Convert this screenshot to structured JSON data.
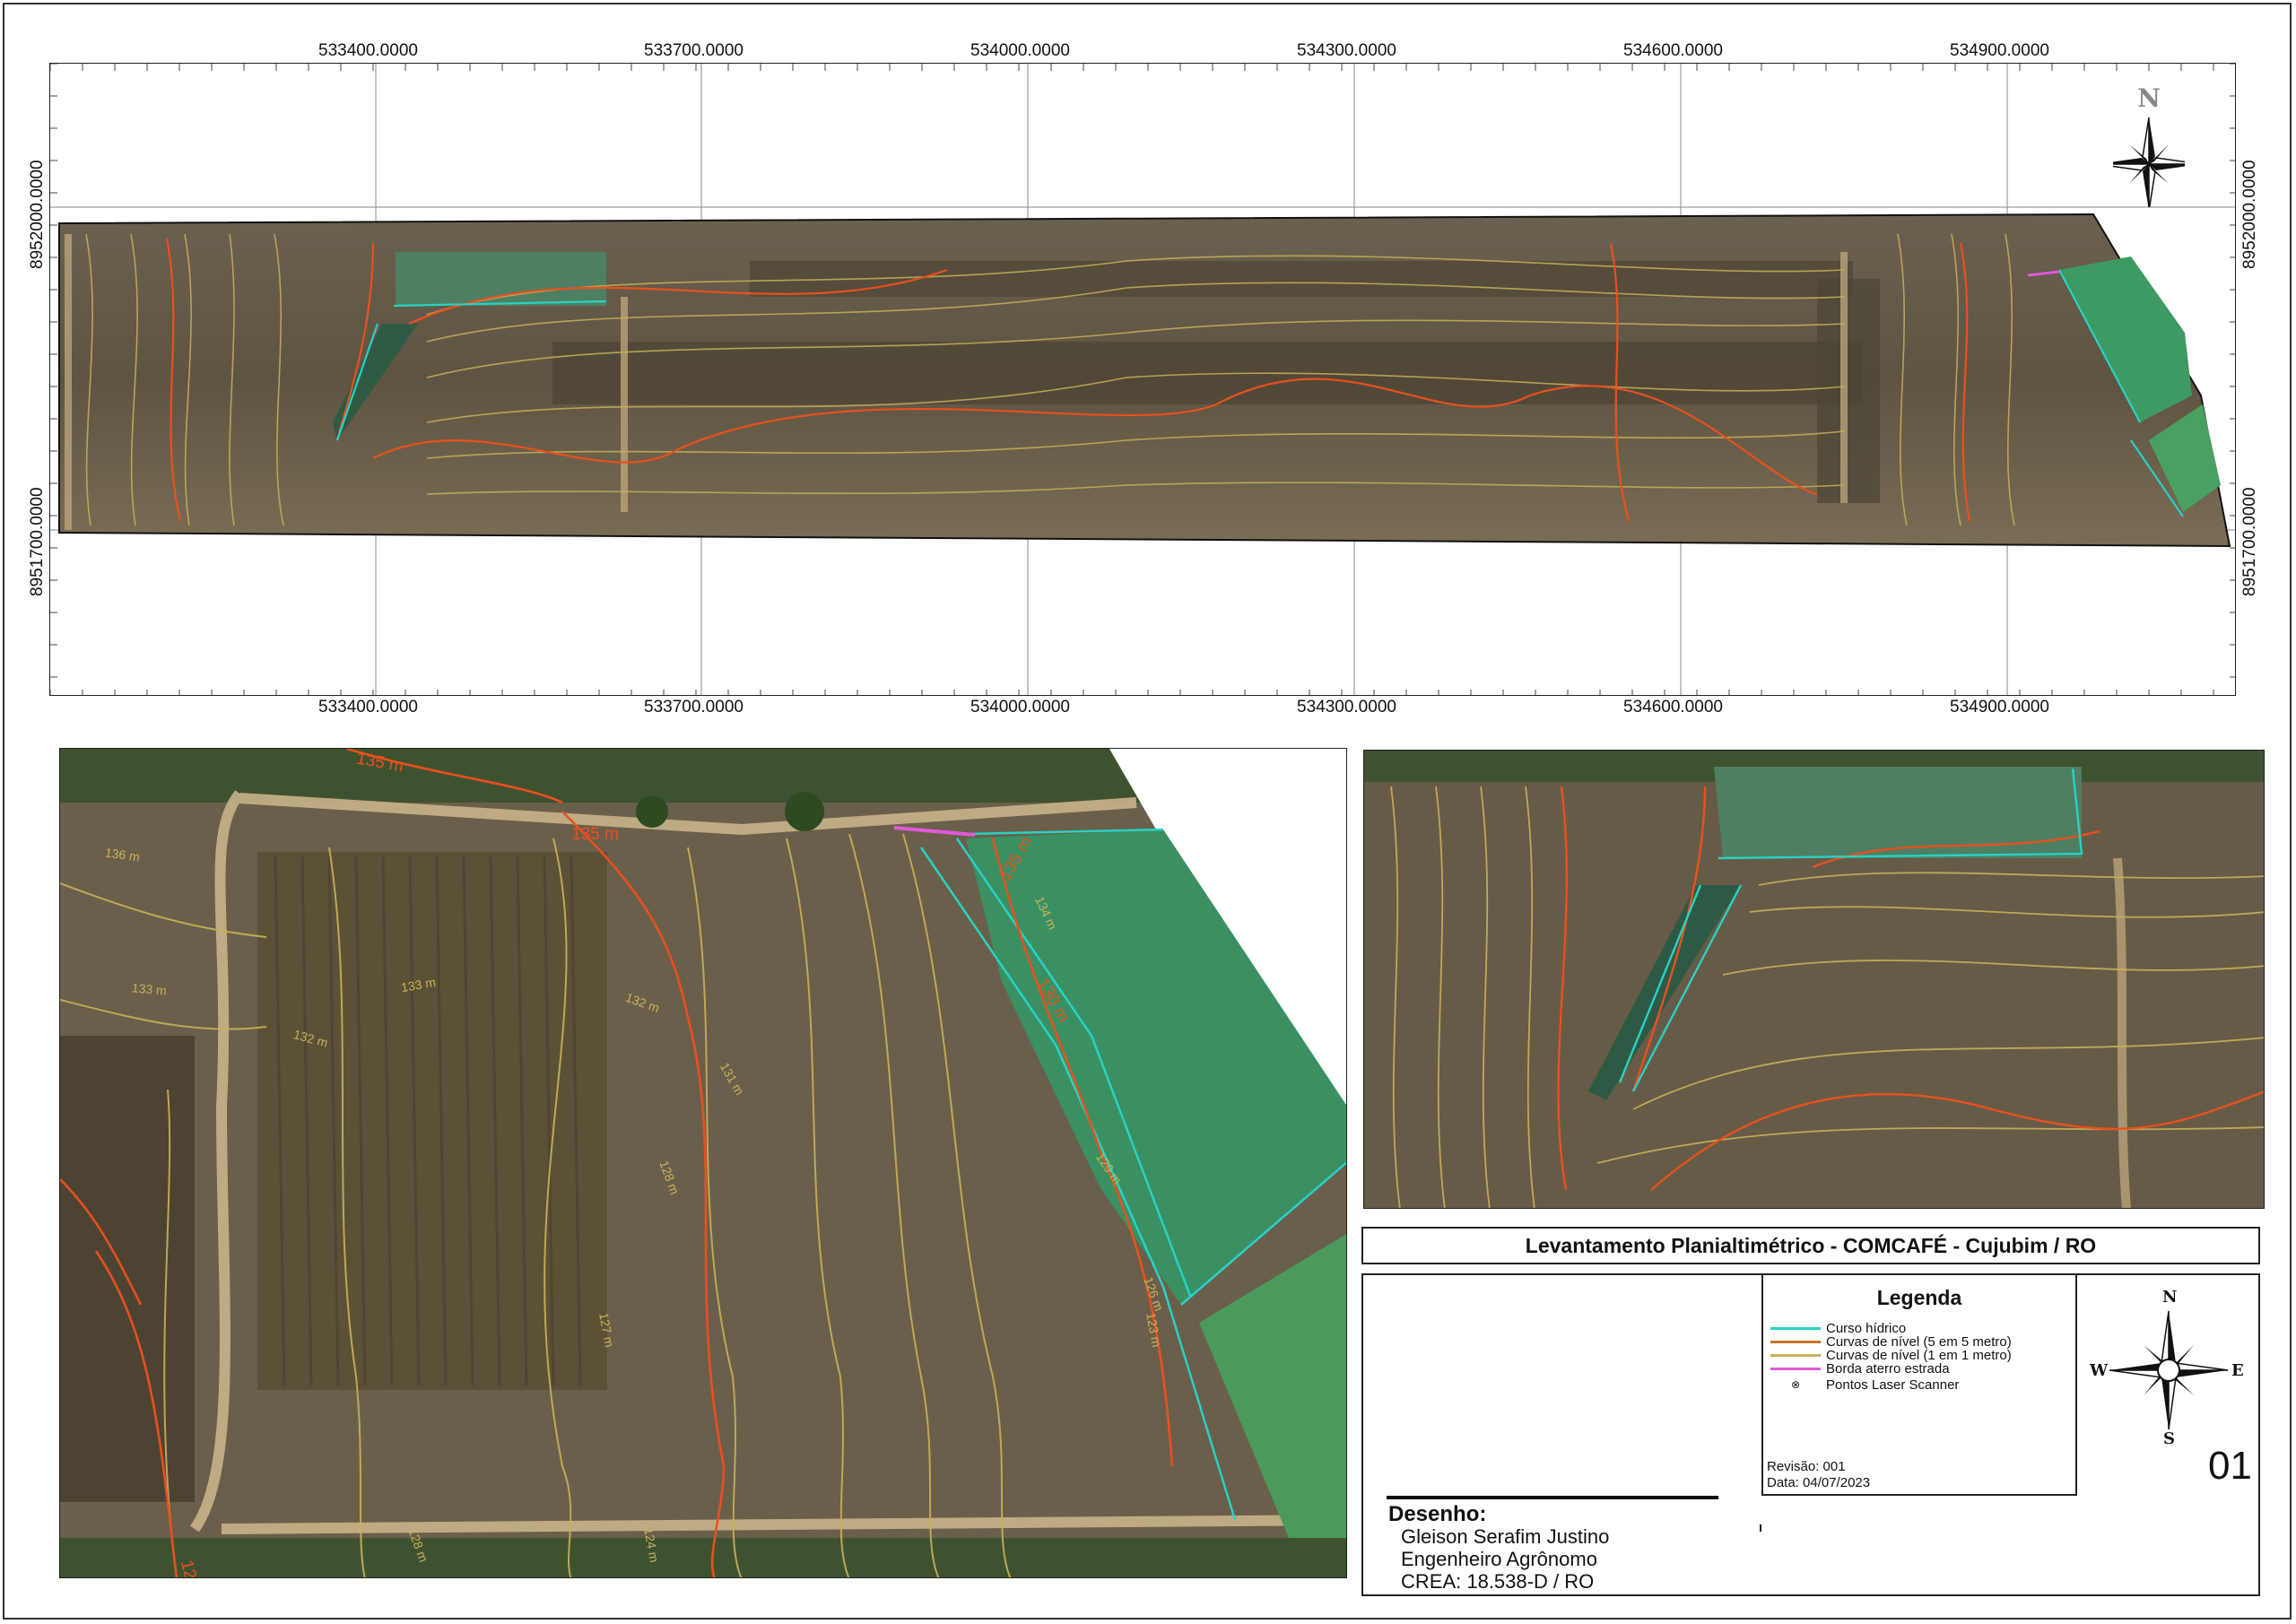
{
  "main_map": {
    "x_labels": [
      "533400.0000",
      "533700.0000",
      "534000.0000",
      "534300.0000",
      "534600.0000",
      "534900.0000"
    ],
    "y_labels": [
      "8952000.0000",
      "8951700.0000"
    ],
    "north_label": "N"
  },
  "detail_left": {
    "contour_labels": [
      "135 m",
      "135 m",
      "136 m",
      "133 m",
      "132 m",
      "135 m",
      "134 m",
      "132 m",
      "131 m",
      "133 m",
      "128 m",
      "130 m",
      "129 m",
      "126 m",
      "127 m",
      "123 m",
      "124 m",
      "125 m",
      "128 m"
    ]
  },
  "title": "Levantamento Planialtimétrico - COMCAFÉ - Cujubim / RO",
  "legend": {
    "title": "Legenda",
    "items": [
      {
        "label": "Curso hídrico",
        "color": "#2ad1c4"
      },
      {
        "label": "Curvas de nível (5 em 5 metro)",
        "color": "#c8742a"
      },
      {
        "label": "Curvas de nível (1 em 1 metro)",
        "color": "#c9b15a"
      },
      {
        "label": "Borda aterro estrada",
        "color": "#e05ad8"
      },
      {
        "label": "Pontos Laser Scanner",
        "color": "#333333"
      }
    ],
    "revision": "Revisão: 001",
    "date": "Data: 04/07/2023"
  },
  "compass": {
    "n": "N",
    "s": "S",
    "e": "E",
    "w": "W"
  },
  "sheet_number": "01",
  "drawing": {
    "heading": "Desenho:",
    "name": "Gleison Serafim Justino",
    "role": "Engenheiro Agrônomo",
    "crea": "CREA: 18.538-D / RO"
  },
  "colors": {
    "contour_major": "#e8501e",
    "contour_minor": "#c9b15a",
    "water_line": "#2ad1c4",
    "pond": "#3f9a6a",
    "field": "#6b5e48"
  }
}
